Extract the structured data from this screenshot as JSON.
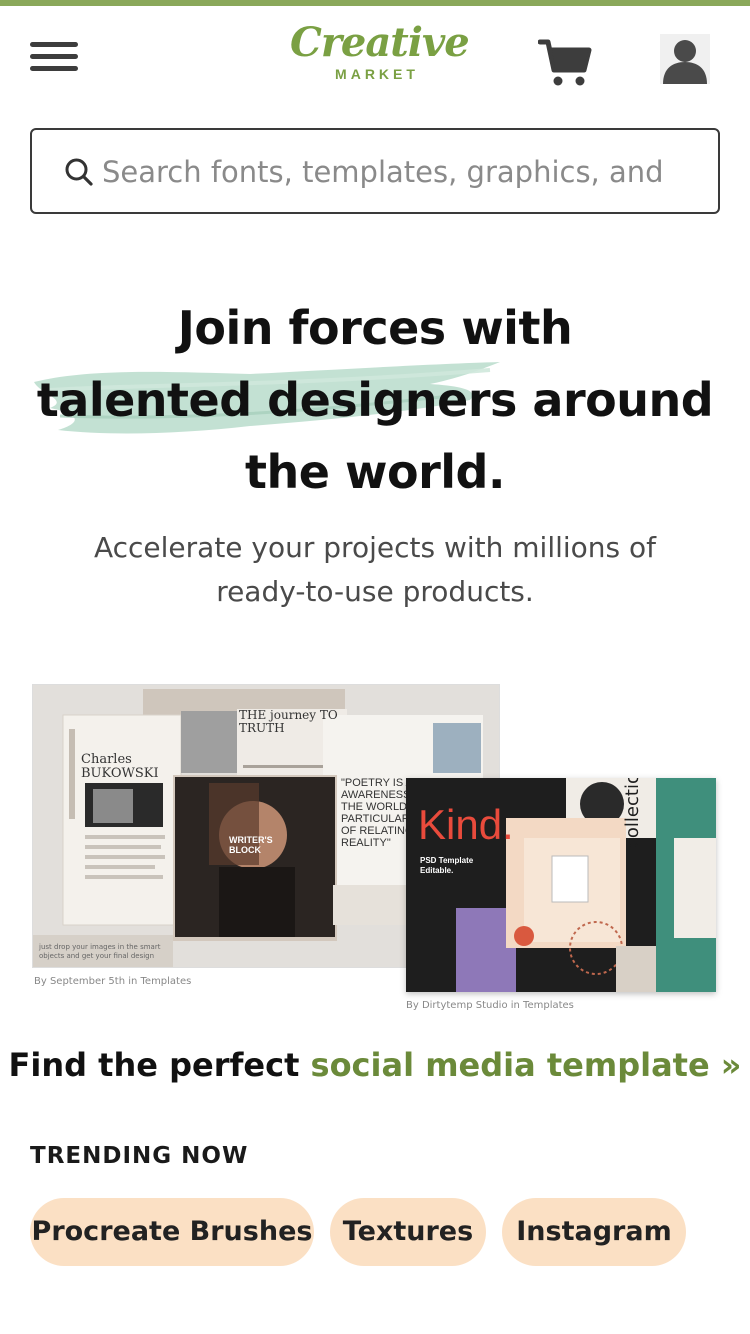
{
  "header": {
    "logo_main": "Creative",
    "logo_sub": "MARKET"
  },
  "search": {
    "placeholder": "Search fonts, templates, graphics, and"
  },
  "hero": {
    "title_line1": "Join forces with",
    "title_line2": "talented designers around",
    "title_line3": "the world.",
    "subtitle_line1": "Accelerate your projects with millions of",
    "subtitle_line2": "ready-to-use products."
  },
  "showcase": {
    "card_a": {
      "credit": "By September 5th in Templates",
      "headline": "THE journey TO TRUTH",
      "author": "Charles BUKOWSKI",
      "poetry": "\"POETRY IS AN AWARENESS OF THE WORLD A PARTICULAR WAY OF RELATING TO REALITY\"",
      "magazine": "WRITER'S BLOCK",
      "caption": "just drop your images in the smart objects and get your final design"
    },
    "card_b": {
      "credit": "By Dirtytemp Studio in Templates",
      "brand": "Kind.",
      "tagline": "PSD Template Editable.",
      "side_text": "collection"
    }
  },
  "promo": {
    "prefix": "Find the perfect ",
    "link": "social media template »"
  },
  "trending": {
    "heading": "TRENDING NOW",
    "chips": [
      "Procreate Brushes",
      "Textures",
      "Instagram"
    ]
  },
  "colors": {
    "brand_green": "#7aa043",
    "link_green": "#6b8a3a",
    "chip_bg": "#fbe0c4",
    "brush_mint": "#b9dccb"
  },
  "icons": {
    "menu": "hamburger-icon",
    "cart": "cart-icon",
    "user": "user-icon",
    "search": "search-icon"
  }
}
